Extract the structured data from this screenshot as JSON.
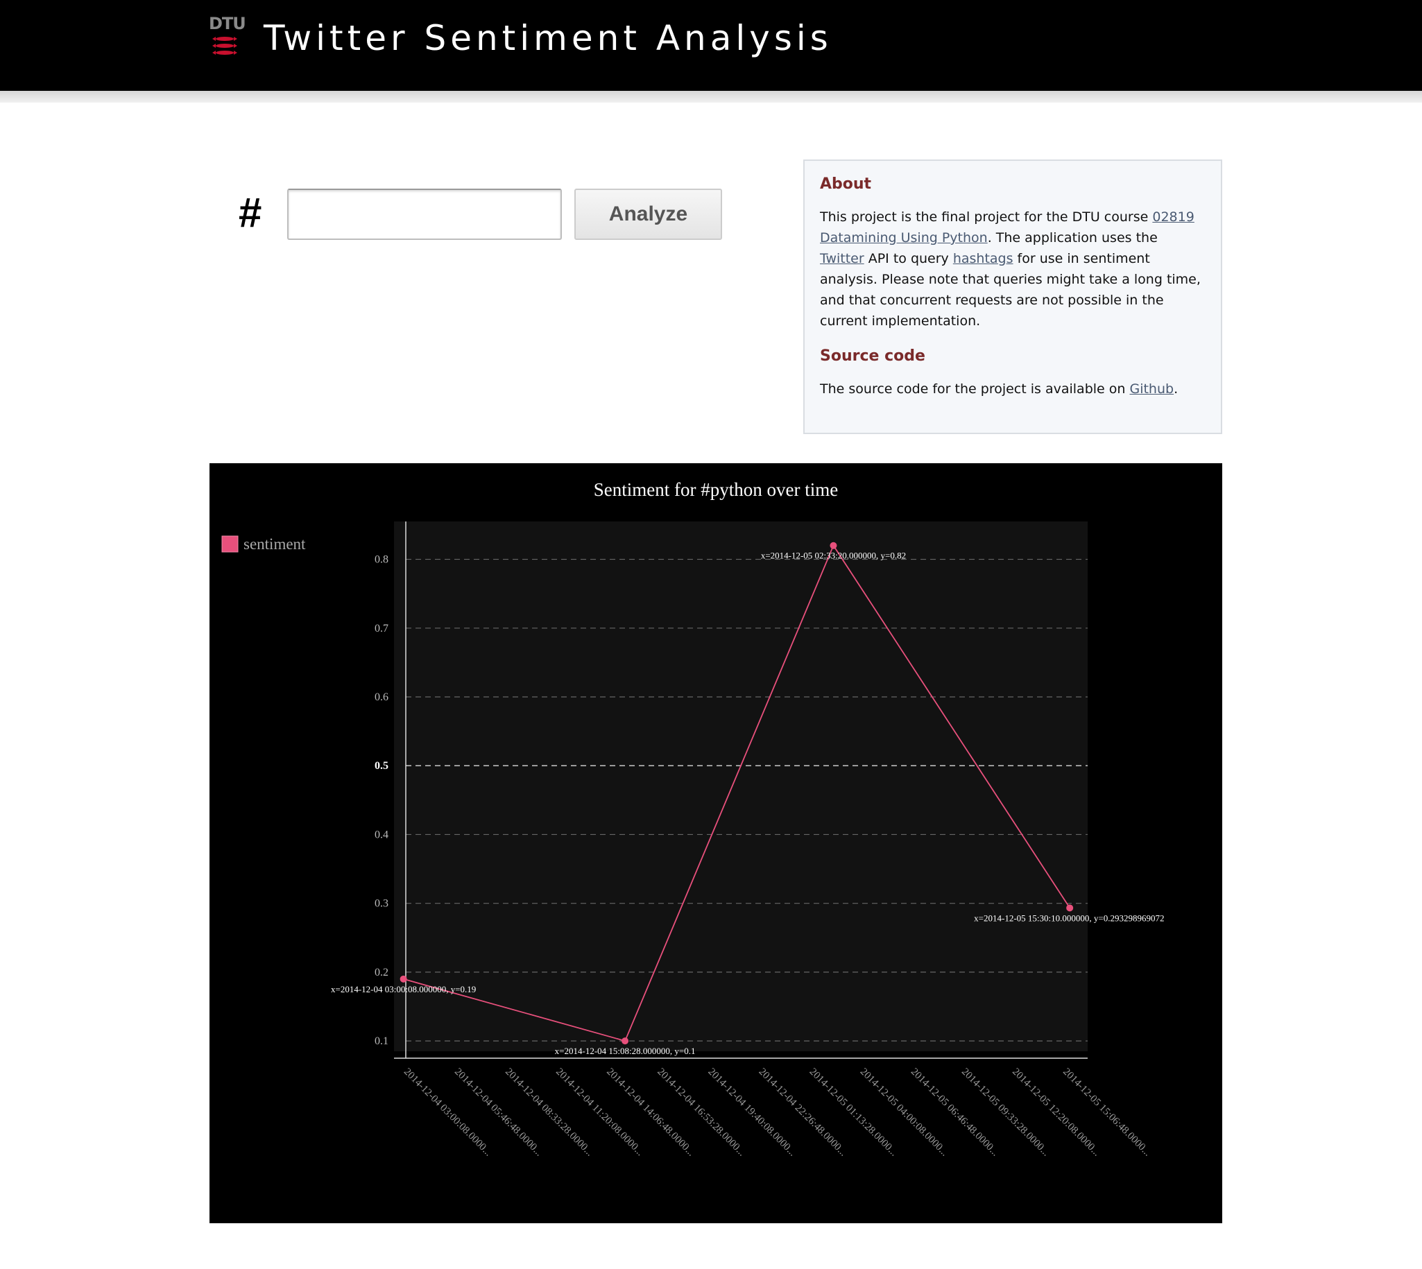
{
  "header": {
    "logo_text": "DTU",
    "title": "Twitter Sentiment Analysis"
  },
  "search": {
    "hash_symbol": "#",
    "value": "",
    "placeholder": "",
    "button_label": "Analyze"
  },
  "about": {
    "heading": "About",
    "text_1": "This project is the final project for the DTU course ",
    "link_course": "02819 Datamining Using Python",
    "text_2": ". The application uses the ",
    "link_twitter": "Twitter",
    "text_3": " API to query ",
    "link_hashtags": "hashtags",
    "text_4": " for use in sentiment analysis. Please note that queries might take a long time, and that concurrent requests are not possible in the current implementation.",
    "source_heading": "Source code",
    "source_text_1": "The source code for the project is available on ",
    "link_github": "Github",
    "source_text_2": "."
  },
  "chart_data": {
    "type": "line",
    "title": "Sentiment for #python over time",
    "xlabel": "",
    "ylabel": "",
    "ylim": [
      0.085,
      0.855
    ],
    "yticks": [
      0.1,
      0.2,
      0.3,
      0.4,
      0.5,
      0.6,
      0.7,
      0.8
    ],
    "ytick_labels": [
      "0.1",
      "0.2",
      "0.3",
      "0.4",
      "0.5",
      "0.6",
      "0.7",
      "0.8"
    ],
    "grid": true,
    "legend_position": "top-left",
    "line_color": "#e8507c",
    "background_color": "#121212",
    "xlim": [
      "2014-12-04 02:45:00",
      "2014-12-05 16:45:00"
    ],
    "xticks": [
      "2014-12-04 03:00:08",
      "2014-12-04 05:46:48",
      "2014-12-04 08:33:28",
      "2014-12-04 11:20:08",
      "2014-12-04 14:06:48",
      "2014-12-04 16:53:28",
      "2014-12-04 19:40:08",
      "2014-12-04 22:26:48",
      "2014-12-05 01:13:28",
      "2014-12-05 04:00:08",
      "2014-12-05 06:46:48",
      "2014-12-05 09:33:28",
      "2014-12-05 12:20:08",
      "2014-12-05 15:06:48"
    ],
    "xtick_labels": [
      "2014-12-04 03:00:08.0000...",
      "2014-12-04 05:46:48.0000...",
      "2014-12-04 08:33:28.0000...",
      "2014-12-04 11:20:08.0000...",
      "2014-12-04 14:06:48.0000...",
      "2014-12-04 16:53:28.0000...",
      "2014-12-04 19:40:08.0000...",
      "2014-12-04 22:26:48.0000...",
      "2014-12-05 01:13:28.0000...",
      "2014-12-05 04:00:08.0000...",
      "2014-12-05 06:46:48.0000...",
      "2014-12-05 09:33:28.0000...",
      "2014-12-05 12:20:08.0000...",
      "2014-12-05 15:06:48.0000..."
    ],
    "series": [
      {
        "name": "sentiment",
        "points": [
          {
            "x": "2014-12-04 03:00:08",
            "y": 0.19,
            "label": "x=2014-12-04 03:00:08.000000, y=0.19"
          },
          {
            "x": "2014-12-04 15:08:28",
            "y": 0.1,
            "label": "x=2014-12-04 15:08:28.000000, y=0.1"
          },
          {
            "x": "2014-12-05 02:33:20",
            "y": 0.82,
            "label": "x=2014-12-05 02:33:20.000000, y=0.82"
          },
          {
            "x": "2014-12-05 15:30:10",
            "y": 0.293298969072,
            "label": "x=2014-12-05 15:30:10.000000, y=0.293298969072"
          }
        ]
      }
    ]
  }
}
